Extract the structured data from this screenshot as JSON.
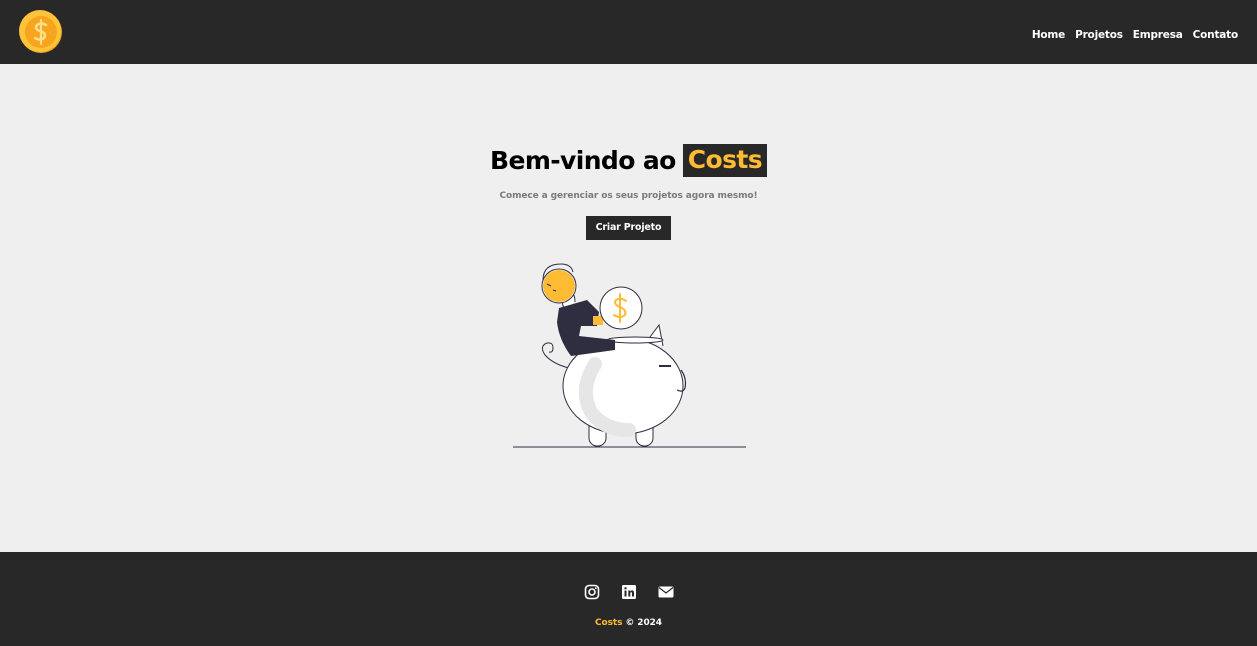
{
  "navbar": {
    "logo_icon": "dollar-coin-icon",
    "links": [
      {
        "label": "Home"
      },
      {
        "label": "Projetos"
      },
      {
        "label": "Empresa"
      },
      {
        "label": "Contato"
      }
    ]
  },
  "hero": {
    "title_prefix": "Bem-vindo ao",
    "title_brand": "Costs",
    "subtitle": "Comece a gerenciar os seus projetos agora mesmo!",
    "cta_label": "Criar Projeto",
    "illustration": "piggy-bank-savings-illustration"
  },
  "footer": {
    "social_icons": [
      "instagram-icon",
      "linkedin-icon",
      "mail-icon"
    ],
    "brand": "Costs",
    "copyright": " © 2024"
  },
  "colors": {
    "dark": "#282828",
    "accent": "#ffbb33",
    "background": "#efefef"
  }
}
